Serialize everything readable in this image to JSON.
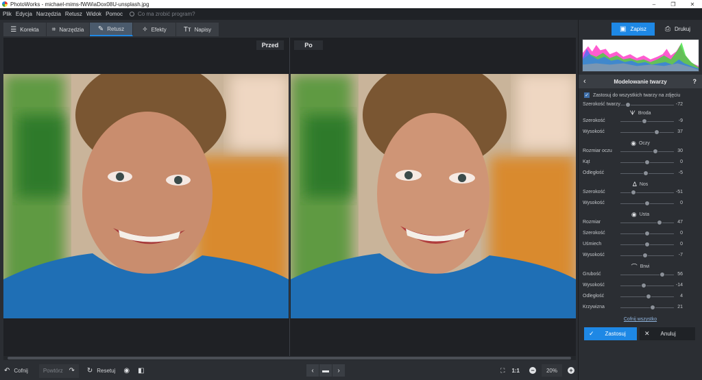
{
  "window": {
    "title": "PhotoWorks - michael-mims-fWWiaDox08U-unsplash.jpg",
    "controls": [
      "–",
      "❐",
      "✕"
    ]
  },
  "menu": {
    "items": [
      "Plik",
      "Edycja",
      "Narzędzia",
      "Retusz",
      "Widok",
      "Pomoc"
    ],
    "search_placeholder": "Co ma zrobić program?"
  },
  "tabs": [
    {
      "label": "Korekta",
      "icon": "sliders-icon",
      "glyph": "☰",
      "active": false
    },
    {
      "label": "Narzędzia",
      "icon": "crop-icon",
      "glyph": "⌗",
      "active": false
    },
    {
      "label": "Retusz",
      "icon": "brush-icon",
      "glyph": "✎",
      "active": true
    },
    {
      "label": "Efekty",
      "icon": "magic-wand-icon",
      "glyph": "✧",
      "active": false
    },
    {
      "label": "Napisy",
      "icon": "text-icon",
      "glyph": "Tт",
      "active": false
    }
  ],
  "canvas": {
    "before_label": "Przed",
    "after_label": "Po"
  },
  "bottom": {
    "undo": "Cofnij",
    "redo": "Powtórz",
    "reset": "Resetuj",
    "zoom_fit": "1:1",
    "zoom_value": "20%"
  },
  "toolbar": {
    "save": "Zapisz",
    "print": "Drukuj"
  },
  "panel": {
    "title": "Modelowanie twarzy",
    "help": "?",
    "apply_all": "Zastosuj do wszystkich twarzy na zdjęciu",
    "reset_all": "Cofnij wszystko",
    "apply": "Zastosuj",
    "cancel": "Anuluj",
    "face_width": {
      "label": "Szerokość twarzy",
      "value": "-72",
      "level": -72
    },
    "sections": [
      {
        "title": "Broda",
        "icon": "chin-icon",
        "glyph": "ᗐ",
        "sliders": [
          {
            "label": "Szerokość",
            "value": "-9",
            "level": -9
          },
          {
            "label": "Wysokość",
            "value": "37",
            "level": 37
          }
        ]
      },
      {
        "title": "Oczy",
        "icon": "eye-icon",
        "glyph": "◉",
        "sliders": [
          {
            "label": "Rozmiar oczu",
            "value": "30",
            "level": 30
          },
          {
            "label": "Kąt",
            "value": "0",
            "level": 0
          },
          {
            "label": "Odległość",
            "value": "-5",
            "level": -5
          }
        ]
      },
      {
        "title": "Nos",
        "icon": "nose-icon",
        "glyph": "ᐃ",
        "sliders": [
          {
            "label": "Szerokość",
            "value": "-51",
            "level": -51
          },
          {
            "label": "Wysokość",
            "value": "0",
            "level": 0
          }
        ]
      },
      {
        "title": "Usta",
        "icon": "lips-icon",
        "glyph": "◉",
        "sliders": [
          {
            "label": "Rozmiar",
            "value": "47",
            "level": 47
          },
          {
            "label": "Szerokość",
            "value": "0",
            "level": 0
          },
          {
            "label": "Uśmiech",
            "value": "0",
            "level": 0
          },
          {
            "label": "Wysokość",
            "value": "-7",
            "level": -7
          }
        ]
      },
      {
        "title": "Brwi",
        "icon": "eyebrow-icon",
        "glyph": "⌒",
        "sliders": [
          {
            "label": "Grubość",
            "value": "56",
            "level": 56
          },
          {
            "label": "Wysokość",
            "value": "-14",
            "level": -14
          },
          {
            "label": "Odległość",
            "value": "4",
            "level": 4
          },
          {
            "label": "Krzywizna",
            "value": "21",
            "level": 21
          }
        ]
      }
    ]
  },
  "colors": {
    "accent": "#1e88e5",
    "panel_bg": "#2b2e33",
    "canvas_bg": "#1f2125"
  }
}
